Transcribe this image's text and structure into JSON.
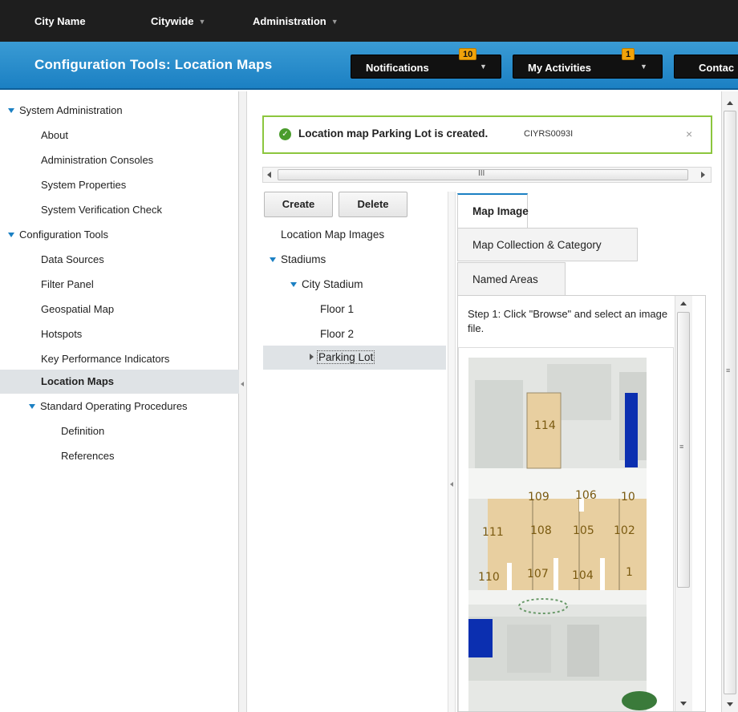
{
  "topnav": {
    "brand": "City Name",
    "citywide": "Citywide",
    "administration": "Administration"
  },
  "header": {
    "title": "Configuration Tools: Location Maps",
    "notifications": {
      "label": "Notifications",
      "count": "10"
    },
    "activities": {
      "label": "My Activities",
      "count": "1"
    },
    "contact": "Contac"
  },
  "sidebar": {
    "items": [
      {
        "label": "System Administration",
        "level": 0,
        "expanded": true
      },
      {
        "label": "About",
        "level": 1
      },
      {
        "label": "Administration Consoles",
        "level": 1
      },
      {
        "label": "System Properties",
        "level": 1
      },
      {
        "label": "System Verification Check",
        "level": 1
      },
      {
        "label": "Configuration Tools",
        "level": 0,
        "expanded": true
      },
      {
        "label": "Data Sources",
        "level": 1
      },
      {
        "label": "Filter Panel",
        "level": 1
      },
      {
        "label": "Geospatial Map",
        "level": 1
      },
      {
        "label": "Hotspots",
        "level": 1
      },
      {
        "label": "Key Performance Indicators",
        "level": 1
      },
      {
        "label": "Location Maps",
        "level": 1,
        "selected": true
      },
      {
        "label": "Standard Operating Procedures",
        "level": 1,
        "expanded": true
      },
      {
        "label": "Definition",
        "level": 2
      },
      {
        "label": "References",
        "level": 2
      }
    ]
  },
  "message": {
    "text": "Location map Parking Lot is created.",
    "code": "CIYRS0093I",
    "close": "×"
  },
  "toolbar": {
    "create": "Create",
    "delete": "Delete"
  },
  "tree": {
    "root": "Location Map Images",
    "items": [
      {
        "label": "Stadiums",
        "level": 0,
        "expanded": true
      },
      {
        "label": "City Stadium",
        "level": 1,
        "expanded": true
      },
      {
        "label": "Floor 1",
        "level": 2
      },
      {
        "label": "Floor 2",
        "level": 2
      },
      {
        "label": "Parking Lot",
        "level": 2,
        "selected": true,
        "collapsed": true
      }
    ]
  },
  "tabs": {
    "map_image": "Map Image",
    "collection": "Map Collection & Category",
    "named_areas": "Named Areas"
  },
  "panel": {
    "step": "Step 1: Click \"Browse\" and select an image file."
  },
  "map": {
    "labels": [
      "114",
      "109",
      "106",
      "10",
      "111",
      "108",
      "105",
      "102",
      "110",
      "107",
      "104",
      "1"
    ]
  }
}
